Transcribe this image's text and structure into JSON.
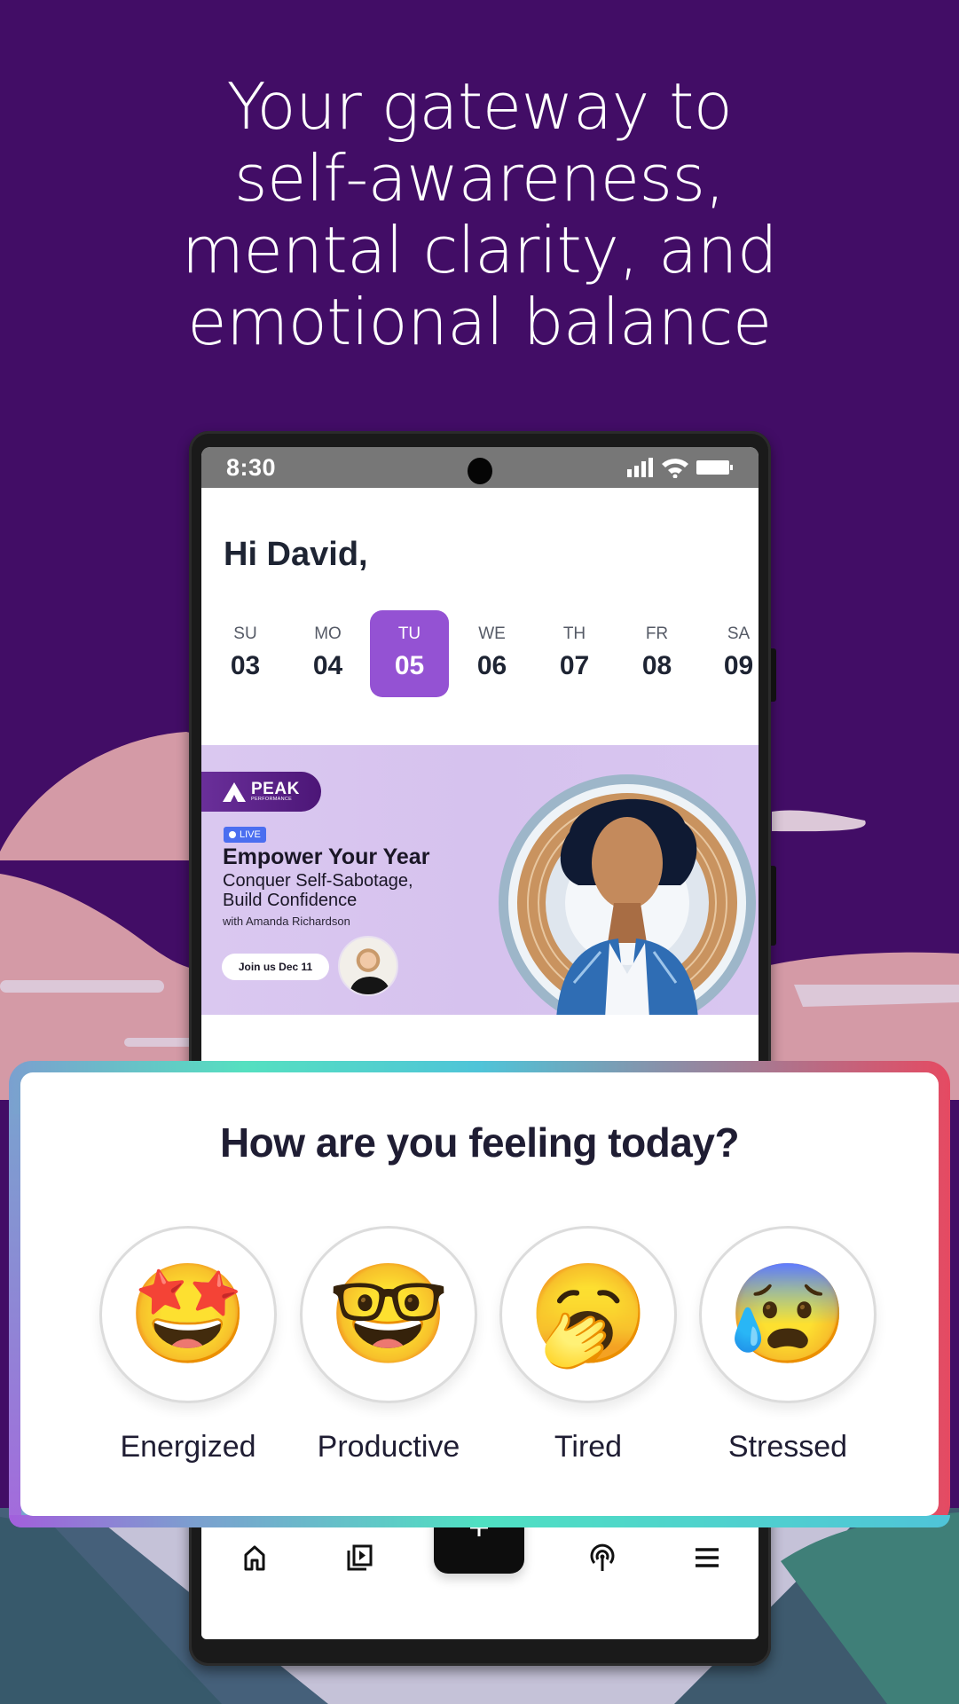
{
  "headline": {
    "lines": [
      "Your gateway to",
      "self-awareness,",
      "mental clarity, and",
      "emotional balance"
    ]
  },
  "colors": {
    "background": "#420d66",
    "accent": "#9452d3",
    "banner_bg": "#d8c6f0",
    "live_badge": "#4b6ef0"
  },
  "status_bar": {
    "time": "8:30",
    "icons": [
      "signal-icon",
      "wifi-icon",
      "battery-icon"
    ]
  },
  "home": {
    "greeting": "Hi David,",
    "week": [
      {
        "dow": "SU",
        "date": "03",
        "selected": false
      },
      {
        "dow": "MO",
        "date": "04",
        "selected": false
      },
      {
        "dow": "TU",
        "date": "05",
        "selected": true
      },
      {
        "dow": "WE",
        "date": "06",
        "selected": false
      },
      {
        "dow": "TH",
        "date": "07",
        "selected": false
      },
      {
        "dow": "FR",
        "date": "08",
        "selected": false
      },
      {
        "dow": "SA",
        "date": "09",
        "selected": false
      }
    ],
    "banner": {
      "brand": "PEAK",
      "brand_sub": "PERFORMANCE",
      "badge": "LIVE",
      "title": "Empower Your Year",
      "subtitle_line1": "Conquer Self-Sabotage,",
      "subtitle_line2": "Build Confidence",
      "host": "with Amanda Richardson",
      "cta": "Join us Dec 11"
    }
  },
  "nav": {
    "items": [
      "home-icon",
      "video-library-icon",
      "add-icon",
      "podcast-icon",
      "menu-icon"
    ],
    "fab_label": "+"
  },
  "mood": {
    "title": "How are you feeling today?",
    "options": [
      {
        "label": "Energized",
        "emoji": "🤩",
        "icon": "star-struck-emoji-icon"
      },
      {
        "label": "Productive",
        "emoji": "🤓",
        "icon": "nerd-face-emoji-icon"
      },
      {
        "label": "Tired",
        "emoji": "🥱",
        "icon": "yawning-face-emoji-icon"
      },
      {
        "label": "Stressed",
        "emoji": "😰",
        "icon": "anxious-sweat-emoji-icon"
      }
    ]
  }
}
